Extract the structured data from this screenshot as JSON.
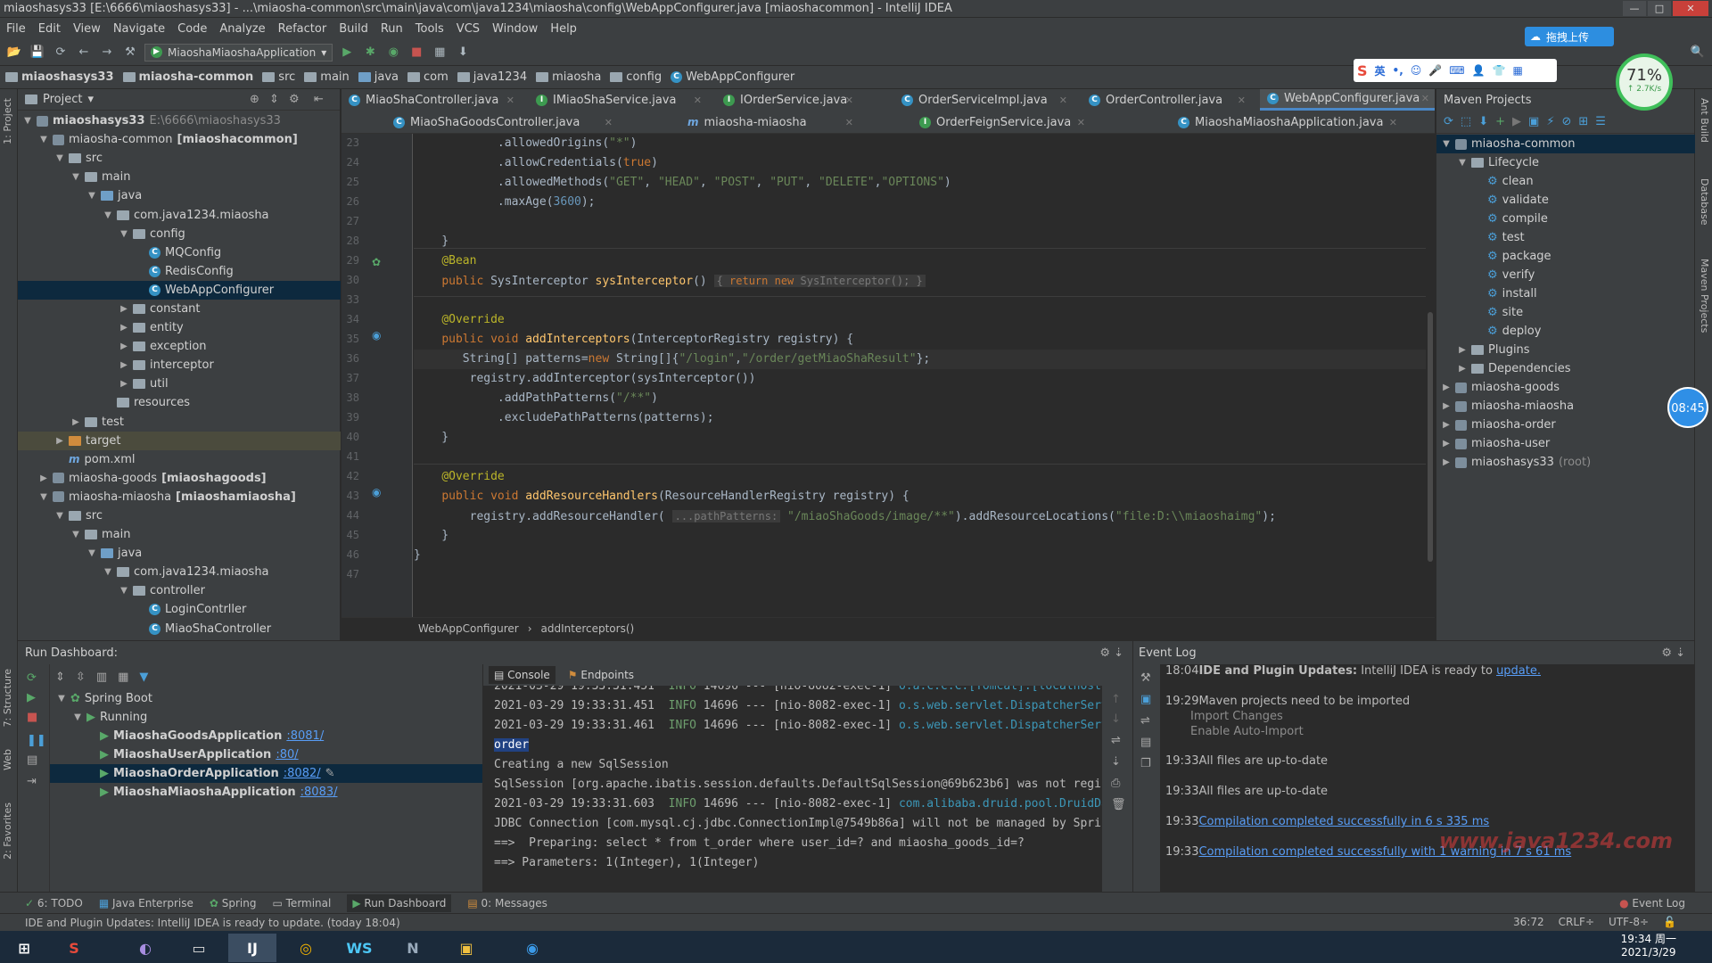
{
  "window": {
    "title": "miaoshasys33 [E:\\6666\\miaoshasys33] - ...\\miaosha-common\\src\\main\\java\\com\\java1234\\miaosha\\config\\WebAppConfigurer.java [miaoshacommon] - IntelliJ IDEA"
  },
  "menu": [
    "File",
    "Edit",
    "View",
    "Navigate",
    "Code",
    "Analyze",
    "Refactor",
    "Build",
    "Run",
    "Tools",
    "VCS",
    "Window",
    "Help"
  ],
  "toolbar": {
    "run_config": "MiaoshaMiaoshaApplication"
  },
  "breadcrumb": [
    "miaoshasys33",
    "miaosha-common",
    "src",
    "main",
    "java",
    "com",
    "java1234",
    "miaosha",
    "config",
    "WebAppConfigurer"
  ],
  "project": {
    "title": "Project",
    "tree": [
      {
        "label": "miaoshasys33",
        "extra": "E:\\6666\\miaoshasys33",
        "indent": 0,
        "arrow": "▼",
        "icon": "module",
        "bold": true
      },
      {
        "label": "miaosha-common",
        "extra": "[miaoshacommon]",
        "indent": 1,
        "arrow": "▼",
        "icon": "module"
      },
      {
        "label": "src",
        "indent": 2,
        "arrow": "▼",
        "icon": "folder"
      },
      {
        "label": "main",
        "indent": 3,
        "arrow": "▼",
        "icon": "folder"
      },
      {
        "label": "java",
        "indent": 4,
        "arrow": "▼",
        "icon": "folder-blue"
      },
      {
        "label": "com.java1234.miaosha",
        "indent": 5,
        "arrow": "▼",
        "icon": "folder"
      },
      {
        "label": "config",
        "indent": 6,
        "arrow": "▼",
        "icon": "folder"
      },
      {
        "label": "MQConfig",
        "indent": 7,
        "arrow": "",
        "icon": "class"
      },
      {
        "label": "RedisConfig",
        "indent": 7,
        "arrow": "",
        "icon": "class"
      },
      {
        "label": "WebAppConfigurer",
        "indent": 7,
        "arrow": "",
        "icon": "class",
        "selected": true
      },
      {
        "label": "constant",
        "indent": 6,
        "arrow": "▶",
        "icon": "folder"
      },
      {
        "label": "entity",
        "indent": 6,
        "arrow": "▶",
        "icon": "folder"
      },
      {
        "label": "exception",
        "indent": 6,
        "arrow": "▶",
        "icon": "folder"
      },
      {
        "label": "interceptor",
        "indent": 6,
        "arrow": "▶",
        "icon": "folder"
      },
      {
        "label": "util",
        "indent": 6,
        "arrow": "▶",
        "icon": "folder"
      },
      {
        "label": "resources",
        "indent": 5,
        "arrow": "",
        "icon": "folder"
      },
      {
        "label": "test",
        "indent": 3,
        "arrow": "▶",
        "icon": "folder"
      },
      {
        "label": "target",
        "indent": 2,
        "arrow": "▶",
        "icon": "folder-orange",
        "highlight": true
      },
      {
        "label": "pom.xml",
        "indent": 2,
        "arrow": "",
        "icon": "maven"
      },
      {
        "label": "miaosha-goods",
        "extra": "[miaoshagoods]",
        "indent": 1,
        "arrow": "▶",
        "icon": "module"
      },
      {
        "label": "miaosha-miaosha",
        "extra": "[miaoshamiaosha]",
        "indent": 1,
        "arrow": "▼",
        "icon": "module"
      },
      {
        "label": "src",
        "indent": 2,
        "arrow": "▼",
        "icon": "folder"
      },
      {
        "label": "main",
        "indent": 3,
        "arrow": "▼",
        "icon": "folder"
      },
      {
        "label": "java",
        "indent": 4,
        "arrow": "▼",
        "icon": "folder-blue"
      },
      {
        "label": "com.java1234.miaosha",
        "indent": 5,
        "arrow": "▼",
        "icon": "folder"
      },
      {
        "label": "controller",
        "indent": 6,
        "arrow": "▼",
        "icon": "folder"
      },
      {
        "label": "LoginContrller",
        "indent": 7,
        "arrow": "",
        "icon": "class"
      },
      {
        "label": "MiaoShaController",
        "indent": 7,
        "arrow": "",
        "icon": "class"
      }
    ]
  },
  "editor_tabs": {
    "row1": [
      {
        "label": "MiaoShaController.java",
        "icon": "class"
      },
      {
        "label": "IMiaoShaService.java",
        "icon": "interface"
      },
      {
        "label": "IOrderService.java",
        "icon": "interface"
      },
      {
        "label": "OrderServiceImpl.java",
        "icon": "class"
      },
      {
        "label": "OrderController.java",
        "icon": "class"
      },
      {
        "label": "WebAppConfigurer.java",
        "icon": "class",
        "active": true
      }
    ],
    "row2": [
      {
        "label": "MiaoShaGoodsController.java",
        "icon": "class"
      },
      {
        "label": "miaosha-miaosha",
        "icon": "maven"
      },
      {
        "label": "OrderFeignService.java",
        "icon": "interface"
      },
      {
        "label": "MiaoshaMiaoshaApplication.java",
        "icon": "class"
      }
    ]
  },
  "code": {
    "line_numbers": [
      "23",
      "24",
      "25",
      "26",
      "27",
      "28",
      "29",
      "30",
      "33",
      "34",
      "35",
      "36",
      "37",
      "38",
      "39",
      "40",
      "41",
      "42",
      "43",
      "44",
      "45",
      "46",
      "47"
    ]
  },
  "editor_breadcrumb": [
    "WebAppConfigurer",
    "addInterceptors()"
  ],
  "maven": {
    "title": "Maven Projects",
    "items": [
      {
        "label": "miaosha-common",
        "indent": 0,
        "arrow": "▼",
        "icon": "module",
        "selected": true
      },
      {
        "label": "Lifecycle",
        "indent": 1,
        "arrow": "▼",
        "icon": "folder"
      },
      {
        "label": "clean",
        "indent": 2,
        "arrow": "",
        "icon": "gear"
      },
      {
        "label": "validate",
        "indent": 2,
        "arrow": "",
        "icon": "gear"
      },
      {
        "label": "compile",
        "indent": 2,
        "arrow": "",
        "icon": "gear"
      },
      {
        "label": "test",
        "indent": 2,
        "arrow": "",
        "icon": "gear"
      },
      {
        "label": "package",
        "indent": 2,
        "arrow": "",
        "icon": "gear"
      },
      {
        "label": "verify",
        "indent": 2,
        "arrow": "",
        "icon": "gear"
      },
      {
        "label": "install",
        "indent": 2,
        "arrow": "",
        "icon": "gear"
      },
      {
        "label": "site",
        "indent": 2,
        "arrow": "",
        "icon": "gear"
      },
      {
        "label": "deploy",
        "indent": 2,
        "arrow": "",
        "icon": "gear"
      },
      {
        "label": "Plugins",
        "indent": 1,
        "arrow": "▶",
        "icon": "folder"
      },
      {
        "label": "Dependencies",
        "indent": 1,
        "arrow": "▶",
        "icon": "folder"
      },
      {
        "label": "miaosha-goods",
        "indent": 0,
        "arrow": "▶",
        "icon": "module"
      },
      {
        "label": "miaosha-miaosha",
        "indent": 0,
        "arrow": "▶",
        "icon": "module"
      },
      {
        "label": "miaosha-order",
        "indent": 0,
        "arrow": "▶",
        "icon": "module"
      },
      {
        "label": "miaosha-user",
        "indent": 0,
        "arrow": "▶",
        "icon": "module"
      },
      {
        "label": "miaoshasys33",
        "extra": "(root)",
        "indent": 0,
        "arrow": "▶",
        "icon": "module"
      }
    ]
  },
  "run_dashboard": {
    "title": "Run Dashboard:",
    "spring_boot": "Spring Boot",
    "running": "Running",
    "apps": [
      {
        "name": "MiaoshaGoodsApplication",
        "port": ":8081/"
      },
      {
        "name": "MiaoshaUserApplication",
        "port": ":80/"
      },
      {
        "name": "MiaoshaOrderApplication",
        "port": ":8082/",
        "selected": true
      },
      {
        "name": "MiaoshaMiaoshaApplication",
        "port": ":8083/"
      }
    ],
    "console_tab": "Console",
    "endpoints_tab": "Endpoints"
  },
  "event_log": {
    "title": "Event Log",
    "entries": [
      {
        "time": "18:04",
        "bold": "IDE and Plugin Updates:",
        "text": " IntelliJ IDEA is ready to ",
        "link": "update."
      },
      {
        "time": "19:29",
        "text": "Maven projects need to be imported"
      },
      {
        "time": "",
        "text": "Import Changes",
        "sub": true
      },
      {
        "time": "",
        "text": "Enable Auto-Import",
        "sub": true
      },
      {
        "time": "19:33",
        "text": "All files are up-to-date"
      },
      {
        "time": "19:33",
        "text": "All files are up-to-date"
      },
      {
        "time": "19:33",
        "link": "Compilation completed successfully in 6 s 335 ms"
      },
      {
        "time": "19:33",
        "link": "Compilation completed successfully with 1 warning in 7 s 61 ms"
      }
    ]
  },
  "bottom_tabs": [
    "6: TODO",
    "Java Enterprise",
    "Spring",
    "Terminal",
    "Run Dashboard",
    "0: Messages"
  ],
  "bottom_right_tab": "Event Log",
  "status": {
    "message": "IDE and Plugin Updates: IntelliJ IDEA is ready to update. (today 18:04)",
    "position": "36:72",
    "line_sep": "CRLF÷",
    "encoding": "UTF-8÷"
  },
  "overlay": {
    "cloud_upload": "拖拽上传",
    "speed_percent": "71%",
    "speed_rate": "↑ 2.7K/s",
    "timer": "08:45",
    "sogou_lang": "英"
  },
  "taskbar": {
    "time": "19:34 周一",
    "date": "2021/3/29"
  },
  "watermark": "www.java1234.com",
  "colors": {
    "editor_bg": "#2b2b2b",
    "panel_bg": "#3c3f41",
    "selection": "#0d293e",
    "keyword": "#cc7832",
    "string": "#6a8759",
    "number": "#6897bb",
    "annotation": "#bbb529",
    "method": "#ffc66d"
  }
}
